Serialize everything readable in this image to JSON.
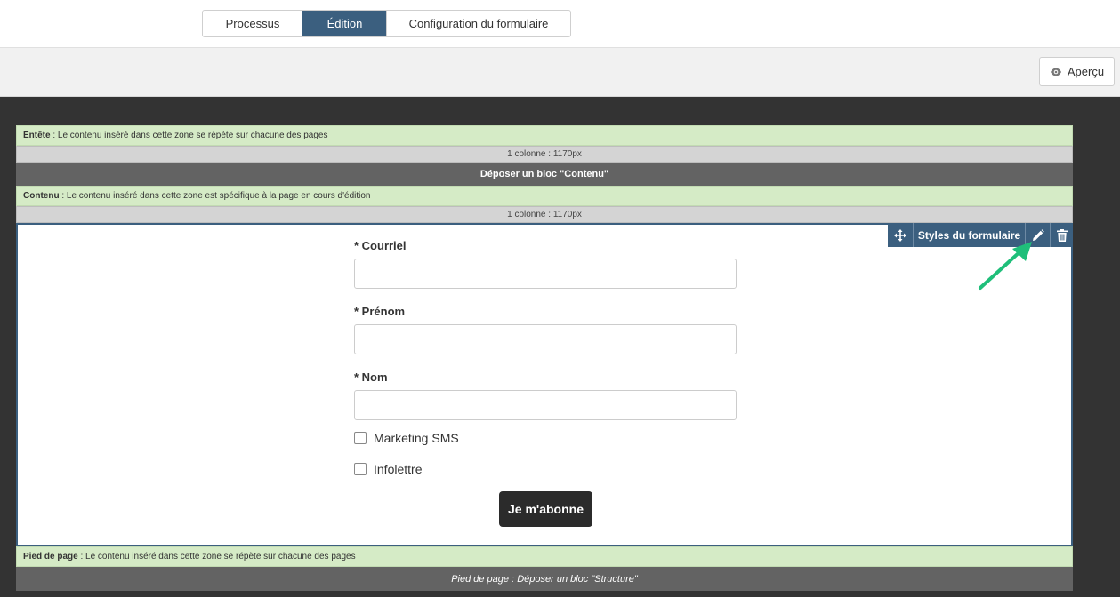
{
  "tabs": [
    {
      "label": "Processus"
    },
    {
      "label": "Édition"
    },
    {
      "label": "Configuration du formulaire"
    }
  ],
  "toolbar": {
    "preview_label": "Aperçu"
  },
  "header_zone": {
    "title": "Entête",
    "text": " : Le contenu inséré dans cette zone se répète sur chacune des pages",
    "columns": "1 colonne : 1170px",
    "drop": "Déposer un bloc \"Contenu\""
  },
  "content_zone": {
    "title": "Contenu",
    "text": " : Le contenu inséré dans cette zone est spécifique à la page en cours d'édition",
    "columns": "1 colonne : 1170px"
  },
  "block": {
    "name": "Styles du formulaire"
  },
  "form": {
    "fields": [
      {
        "label": "* Courriel"
      },
      {
        "label": "* Prénom"
      },
      {
        "label": "* Nom"
      }
    ],
    "checkboxes": [
      {
        "label": "Marketing SMS"
      },
      {
        "label": "Infolettre"
      }
    ],
    "submit_label": "Je m'abonne"
  },
  "footer_zone": {
    "title": "Pied de page",
    "text": " : Le contenu inséré dans cette zone se répète sur chacune des pages",
    "drop": "Pied de page : Déposer un bloc \"Structure\""
  },
  "colors": {
    "accent": "#3b5f7f",
    "zone_green": "#d5ebc6",
    "arrow": "#1fbf7a"
  }
}
